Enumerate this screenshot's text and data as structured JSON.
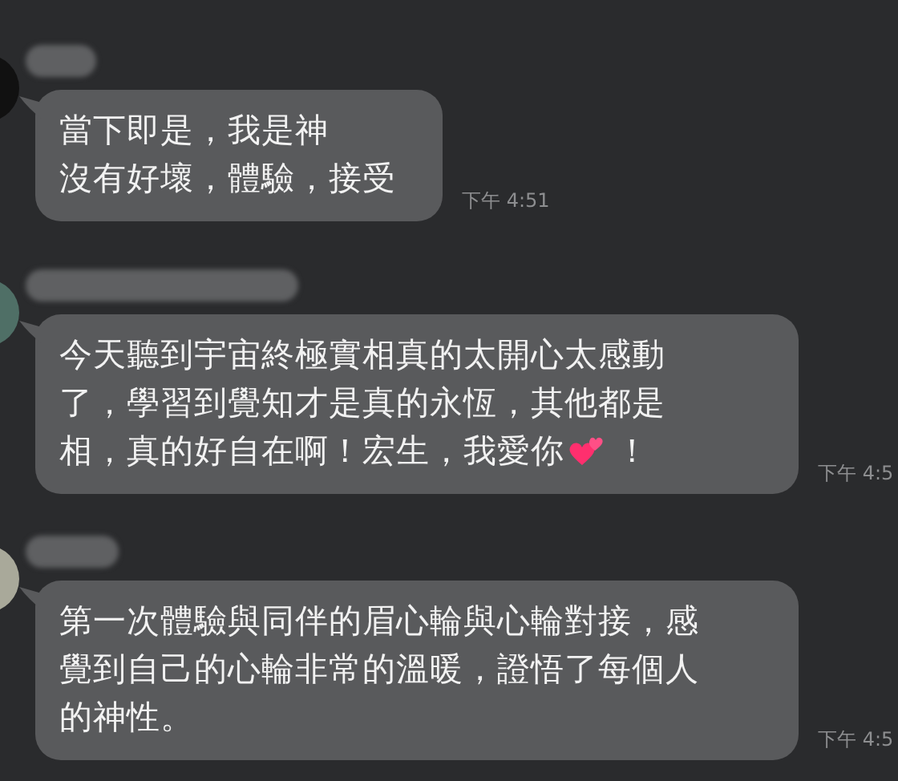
{
  "messages": [
    {
      "segments": [
        {
          "kind": "text",
          "lines": [
            "當下即是，我是神",
            "沒有好壞，體驗，接受"
          ]
        }
      ],
      "time": "下午 4:51"
    },
    {
      "segments": [
        {
          "kind": "text",
          "lines": [
            "今天聽到宇宙終極實相真的太開心太感動",
            "了，學習到覺知才是真的永恆，其他都是"
          ]
        },
        {
          "kind": "text",
          "lines": [
            "相，真的好自在啊！宏生，我愛你"
          ]
        },
        {
          "kind": "hearts"
        },
        {
          "kind": "text",
          "lines": [
            "！"
          ]
        }
      ],
      "time": "下午 4:5"
    },
    {
      "segments": [
        {
          "kind": "text",
          "lines": [
            "第一次體驗與同伴的眉心輪與心輪對接，感",
            "覺到自己的心輪非常的溫暖，證悟了每個人",
            "的神性。"
          ]
        }
      ],
      "time": "下午 4:5"
    }
  ]
}
